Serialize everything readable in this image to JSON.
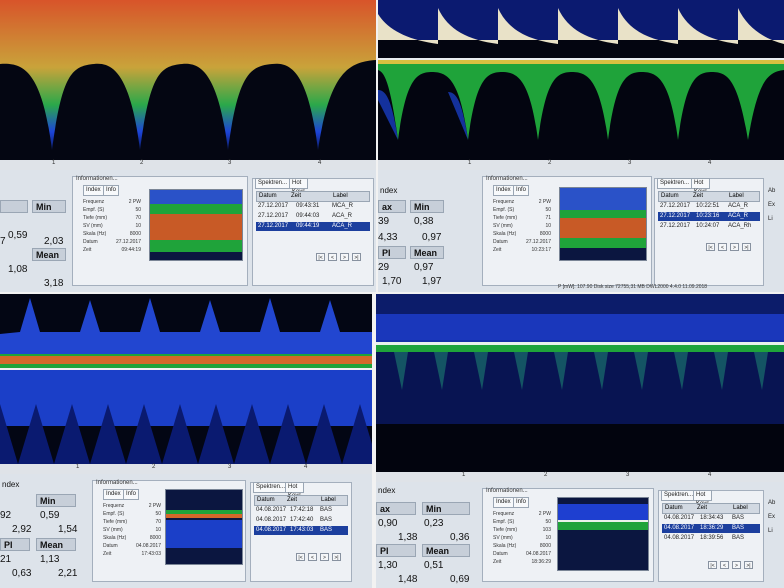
{
  "panels": [
    {
      "id": "tl",
      "axis_ticks": [
        "1",
        "2",
        "3",
        "4"
      ],
      "stats": {
        "max_label": "",
        "max_values": [
          "",
          "7"
        ],
        "min_label": "Min",
        "min_values": [
          "0,59",
          "2,03"
        ],
        "pi_label": "",
        "pi_values": [
          "",
          ""
        ],
        "mean_label": "Mean",
        "mean_values": [
          "1,08",
          "3,18"
        ]
      },
      "info": {
        "title": "Informationen...",
        "tab_index": "Index",
        "tab_info": "Info",
        "fields": [
          [
            "Frequenz",
            "2 PW"
          ],
          [
            "Empf. (S)",
            "50"
          ],
          [
            "Tiefe (mm)",
            "70"
          ],
          [
            "SV (mm)",
            "10"
          ],
          [
            "Skala (Hz)",
            "8000"
          ],
          [
            "Datum",
            "27.12.2017"
          ],
          [
            "Zeit",
            "09:44:19"
          ]
        ],
        "thumb_ticks": [
          "1",
          "2",
          "3",
          "4"
        ]
      },
      "spektren": {
        "tab1": "Spektren...",
        "tab2": "Hot Keys",
        "col_date": "Datum",
        "col_time": "Zeit",
        "col_label": "Label",
        "rows": [
          [
            "27.12.2017",
            "09:43:31",
            "MCA_R"
          ],
          [
            "27.12.2017",
            "09:44:03",
            "ACA_R"
          ],
          [
            "27.12.2017",
            "09:44:19",
            "ACA_R"
          ]
        ],
        "selected": 2
      },
      "status": "",
      "side_icons": []
    },
    {
      "id": "tr",
      "axis_ticks": [
        "1",
        "2",
        "3",
        "4"
      ],
      "stats": {
        "max_label": "ax",
        "max_values": [
          "39",
          "4,33"
        ],
        "min_label": "Min",
        "min_values": [
          "0,38",
          "0,97"
        ],
        "pi_label": "PI",
        "pi_values": [
          "29",
          "1,70"
        ],
        "mean_label": "Mean",
        "mean_values": [
          "0,97",
          "1,97"
        ]
      },
      "info": {
        "title": "Informationen...",
        "tab_index": "Index",
        "tab_info": "Info",
        "fields": [
          [
            "Frequenz",
            "2 PW"
          ],
          [
            "Empf. (S)",
            "50"
          ],
          [
            "Tiefe (mm)",
            "71"
          ],
          [
            "SV (mm)",
            "10"
          ],
          [
            "Skala (Hz)",
            "8000"
          ],
          [
            "Datum",
            "27.12.2017"
          ],
          [
            "Zeit",
            "10:23:17"
          ]
        ],
        "thumb_ticks": [
          "1",
          "2",
          "3",
          "4"
        ]
      },
      "spektren": {
        "tab1": "Spektren...",
        "tab2": "Hot Keys",
        "col_date": "Datum",
        "col_time": "Zeit",
        "col_label": "Label",
        "rows": [
          [
            "27.12.2017",
            "10:22:51",
            "ACA_R"
          ],
          [
            "27.12.2017",
            "10:23:16",
            "ACA_R"
          ],
          [
            "27.12.2017",
            "10:24:07",
            "ACA_Rh"
          ]
        ],
        "selected": 1
      },
      "status": "P [mW]: 107.90      Disk size 72755,31 MB      DWL2000 4.4.0      11.09.2018",
      "side_icons": [
        "Ab",
        "Ex",
        "Li"
      ]
    },
    {
      "id": "bl",
      "axis_ticks": [
        "1",
        "2",
        "3",
        "4"
      ],
      "stats": {
        "max_label": "",
        "max_values": [
          "92",
          "2,92"
        ],
        "min_label": "Min",
        "min_values": [
          "0,59",
          "1,54"
        ],
        "pi_label": "PI",
        "pi_values": [
          "21",
          "0,63"
        ],
        "mean_label": "Mean",
        "mean_values": [
          "1,13",
          "2,21"
        ]
      },
      "info": {
        "title": "Informationen...",
        "tab_index": "Index",
        "tab_info": "Info",
        "fields": [
          [
            "Frequenz",
            "2 PW"
          ],
          [
            "Empf. (S)",
            "50"
          ],
          [
            "Tiefe (mm)",
            "70"
          ],
          [
            "SV (mm)",
            "10"
          ],
          [
            "Skala (Hz)",
            "8000"
          ],
          [
            "Datum",
            "04.08.2017"
          ],
          [
            "Zeit",
            "17:43:03"
          ]
        ],
        "thumb_ticks": [
          "1",
          "2",
          "3",
          "4"
        ]
      },
      "spektren": {
        "tab1": "Spektren...",
        "tab2": "Hot Keys",
        "col_date": "Datum",
        "col_time": "Zeit",
        "col_label": "Label",
        "rows": [
          [
            "04.08.2017",
            "17:42:18",
            "BAS"
          ],
          [
            "04.08.2017",
            "17:42:40",
            "BAS"
          ],
          [
            "04.08.2017",
            "17:43:03",
            "BAS"
          ]
        ],
        "selected": 2
      },
      "status": "",
      "side_icons": []
    },
    {
      "id": "br",
      "axis_ticks": [
        "1",
        "2",
        "3",
        "4"
      ],
      "stats": {
        "max_label": "ax",
        "max_values": [
          "0,90",
          "1,38"
        ],
        "min_label": "Min",
        "min_values": [
          "0,23",
          "0,36"
        ],
        "pi_label": "PI",
        "pi_values": [
          "1,30",
          "1,48"
        ],
        "mean_label": "Mean",
        "mean_values": [
          "0,51",
          "0,69"
        ]
      },
      "info": {
        "title": "Informationen...",
        "tab_index": "Index",
        "tab_info": "Info",
        "fields": [
          [
            "Frequenz",
            "2 PW"
          ],
          [
            "Empf. (S)",
            "50"
          ],
          [
            "Tiefe (mm)",
            "103"
          ],
          [
            "SV (mm)",
            "10"
          ],
          [
            "Skala (Hz)",
            "8000"
          ],
          [
            "Datum",
            "04.08.2017"
          ],
          [
            "Zeit",
            "18:36:29"
          ]
        ],
        "thumb_ticks": [
          "1",
          "2",
          "3",
          "4"
        ]
      },
      "spektren": {
        "tab1": "Spektren...",
        "tab2": "Hot Keys",
        "col_date": "Datum",
        "col_time": "Zeit",
        "col_label": "Label",
        "rows": [
          [
            "04.08.2017",
            "18:34:43",
            "BAS"
          ],
          [
            "04.08.2017",
            "18:36:29",
            "BAS"
          ],
          [
            "04.08.2017",
            "18:39:56",
            "BAS"
          ]
        ],
        "selected": 1
      },
      "status": "",
      "side_icons": [
        "Ab",
        "Ex",
        "Li"
      ]
    }
  ],
  "section_heading": "ndex",
  "icons": {
    "ctrl_prev": "prev-icon",
    "ctrl_next": "next-icon",
    "ctrl_first": "first-icon",
    "ctrl_last": "last-icon"
  },
  "colors": {
    "spectrum_hot": "#d23a1a",
    "spectrum_mid": "#1fa33a",
    "spectrum_low": "#1e3fd8",
    "background": "#050814",
    "selection": "#1c3f9e"
  }
}
